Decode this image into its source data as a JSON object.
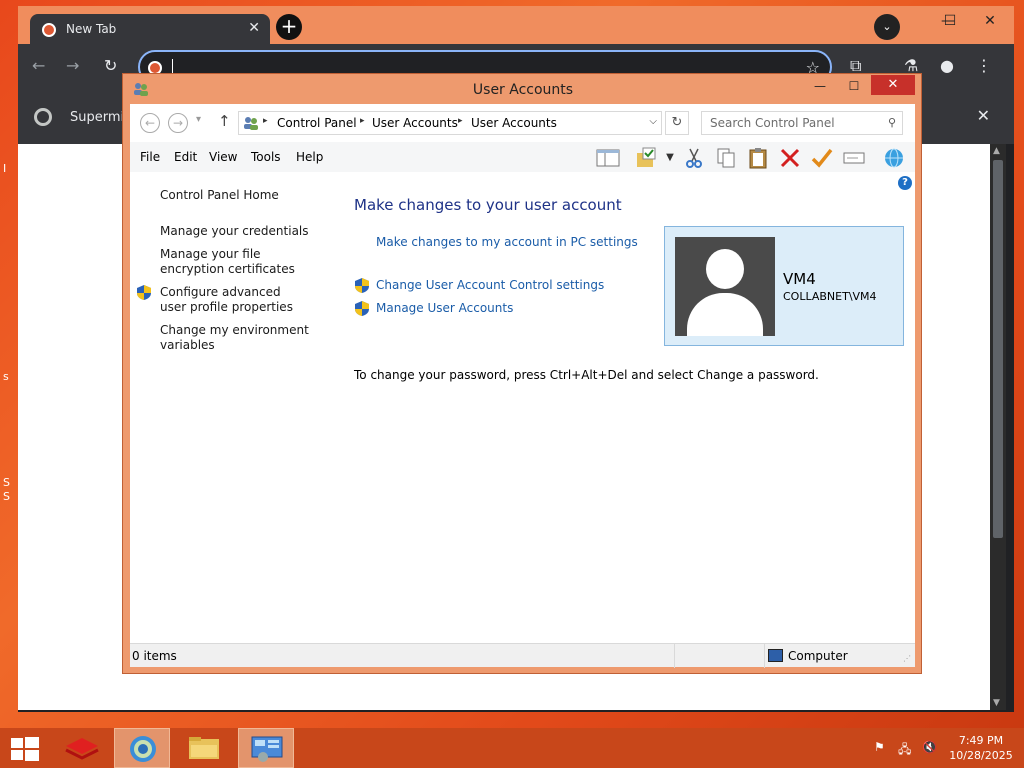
{
  "browser": {
    "tab_title": "New Tab",
    "tab_close": "✕",
    "new_tab": "+",
    "tab_search": "⌄",
    "minimize": "—",
    "maximize": "☐",
    "close": "✕",
    "back": "←",
    "forward": "→",
    "reload": "↻",
    "bookmark_star": "☆",
    "extensions": "⧉",
    "labs": "⚗",
    "profile": "●",
    "menu": "⋮",
    "bookmark_label": "Supermiu",
    "bookmark_close": "✕"
  },
  "window": {
    "title": "User Accounts",
    "minimize": "—",
    "maximize": "☐",
    "close": "✕"
  },
  "address": {
    "back": "←",
    "forward": "→",
    "dropdown": "▾",
    "up": "↑",
    "crumbs": [
      "Control Panel",
      "User Accounts",
      "User Accounts"
    ],
    "separator": "▸",
    "expand": "⌵",
    "refresh": "↻",
    "search_placeholder": "Search Control Panel",
    "search_icon": "⚲"
  },
  "menu": [
    "File",
    "Edit",
    "View",
    "Tools",
    "Help"
  ],
  "toolbar_icons": [
    "preview-pane-icon",
    "folder-properties-icon",
    "dropdown-icon",
    "cut-icon",
    "copy-icon",
    "paste-icon",
    "delete-icon",
    "checkmark-icon",
    "rename-icon",
    "globe-icon"
  ],
  "help": "?",
  "left_pane": {
    "items": [
      "Control Panel Home",
      "Manage your credentials",
      "Manage your file encryption certificates",
      "Configure advanced user profile properties",
      "Change my environment variables"
    ]
  },
  "main": {
    "heading": "Make changes to your user account",
    "links": [
      "Make changes to my account in PC settings",
      "Change User Account Control settings",
      "Manage User Accounts"
    ],
    "password_note": "To change your password, press Ctrl+Alt+Del and select Change a password."
  },
  "user": {
    "name": "VM4",
    "domain": "COLLABNET\\VM4"
  },
  "status": {
    "items": "0 items",
    "location": "Computer"
  },
  "taskbar": {
    "time": "7:49 PM",
    "date": "10/28/2025"
  },
  "desktop_fragments": [
    "I",
    "s",
    "S",
    "S"
  ],
  "colors": {
    "desktop": "#e8481c",
    "chrome_frame": "#f08d5d",
    "chrome_dark": "#35363a",
    "window_frame": "#ee9a6e",
    "close_red": "#c7302a",
    "link_blue": "#1a5ca8",
    "heading_blue": "#1e3287",
    "taskbar": "#c8471a"
  }
}
